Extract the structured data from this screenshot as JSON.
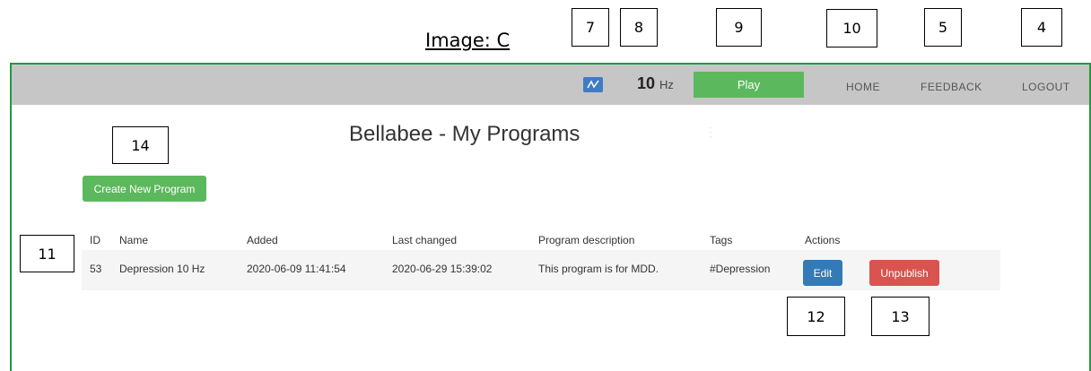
{
  "caption": "Image: C",
  "navbar": {
    "frequency_value": "10",
    "frequency_unit": "Hz",
    "play_label": "Play",
    "links": {
      "home": "HOME",
      "feedback": "FEEDBACK",
      "logout": "LOGOUT"
    }
  },
  "main": {
    "title": "Bellabee - My Programs",
    "create_label": "Create New Program"
  },
  "table": {
    "headers": {
      "id": "ID",
      "name": "Name",
      "added": "Added",
      "last_changed": "Last changed",
      "description": "Program description",
      "tags": "Tags",
      "actions": "Actions"
    },
    "rows": [
      {
        "id": "53",
        "name": "Depression 10 Hz",
        "added": "2020-06-09 11:41:54",
        "last_changed": "2020-06-29 15:39:02",
        "description": "This program is for MDD.",
        "tags": "#Depression",
        "edit_label": "Edit",
        "unpublish_label": "Unpublish"
      }
    ]
  },
  "annotations": {
    "a7": "7",
    "a8": "8",
    "a9": "9",
    "a10": "10",
    "a5": "5",
    "a4": "4",
    "a14": "14",
    "a11": "11",
    "a12": "12",
    "a13": "13"
  },
  "colors": {
    "frame_border": "#1f9b3f",
    "navbar_bg": "#c6c6c6",
    "success_green": "#5cb85c",
    "primary_blue": "#337ab7",
    "danger_red": "#d9534f"
  },
  "icons": {
    "wave": "wave-icon"
  }
}
